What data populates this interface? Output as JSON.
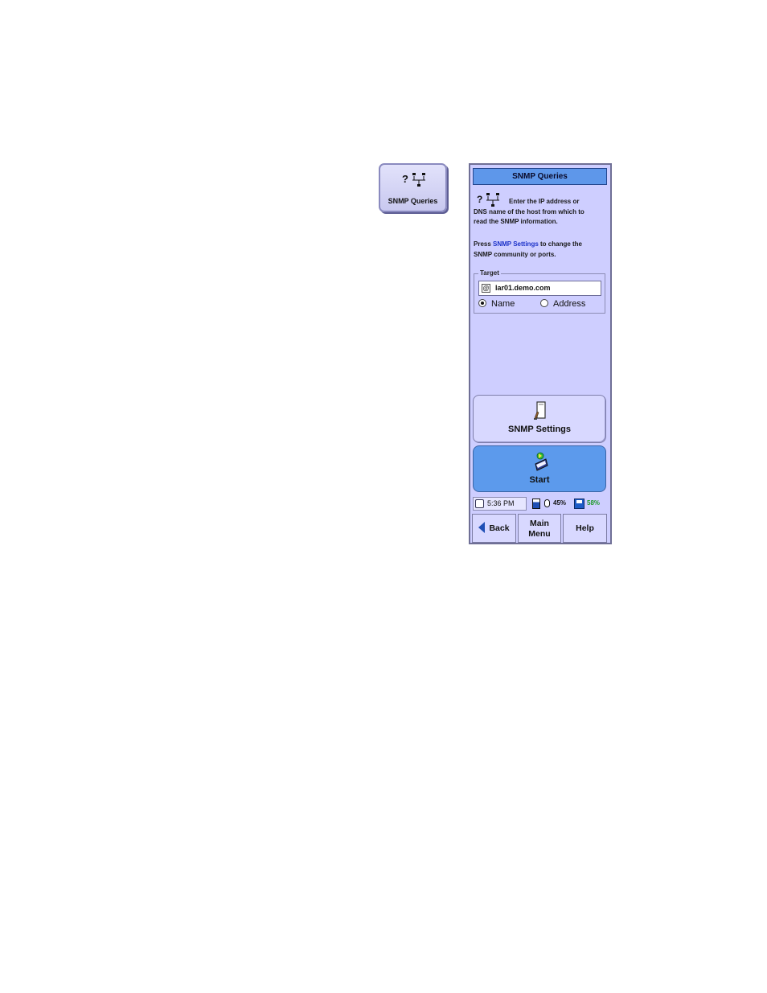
{
  "launcher": {
    "label": "SNMP Queries",
    "icon": "network-query-icon"
  },
  "panel": {
    "title": "SNMP Queries",
    "instructions": {
      "line1": "Enter the IP address or",
      "line2": "DNS name of the host from which to",
      "line3": "read the SNMP information."
    },
    "settings_hint": {
      "prefix": "Press ",
      "link": "SNMP Settings",
      "suffix": " to change the",
      "line2": "SNMP community or ports."
    },
    "target": {
      "legend": "Target",
      "value": "lar01.demo.com",
      "radio_name": "Name",
      "radio_address": "Address",
      "selected": "Name"
    },
    "settings_button": "SNMP Settings",
    "start_button": "Start",
    "status": {
      "time": "5:36 PM",
      "battery": "45%",
      "disk": "58%",
      "disk_color": "#1f9a2a"
    },
    "nav": {
      "back": "Back",
      "main_line1": "Main",
      "main_line2": "Menu",
      "help": "Help"
    }
  }
}
